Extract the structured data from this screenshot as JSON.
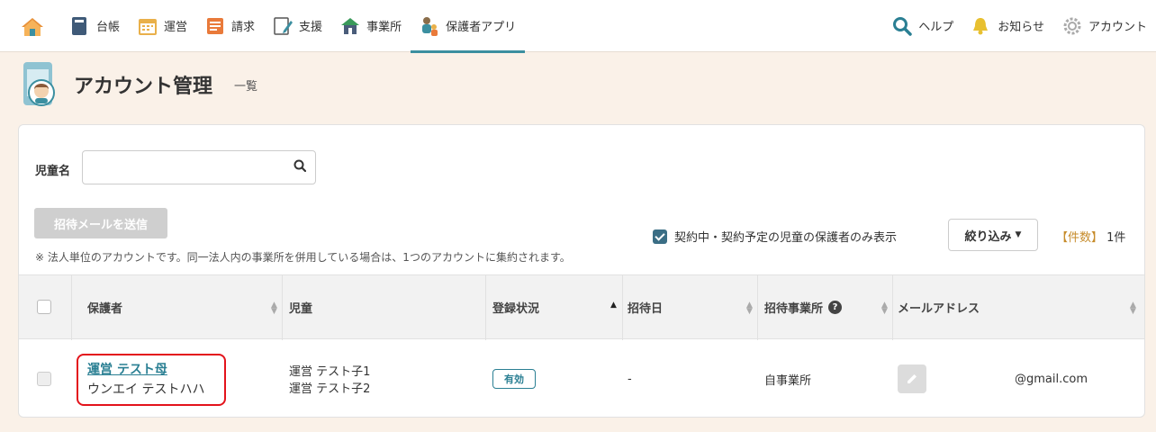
{
  "nav": {
    "items": [
      {
        "label": "台帳",
        "icon": "ledger-icon"
      },
      {
        "label": "運営",
        "icon": "calendar-icon"
      },
      {
        "label": "請求",
        "icon": "invoice-icon"
      },
      {
        "label": "支援",
        "icon": "support-icon"
      },
      {
        "label": "事業所",
        "icon": "office-icon"
      },
      {
        "label": "保護者アプリ",
        "icon": "parent-app-icon"
      }
    ],
    "active_index": 5,
    "help": "ヘルプ",
    "notice": "お知らせ",
    "account": "アカウント"
  },
  "page": {
    "title": "アカウント管理",
    "subtitle": "一覧"
  },
  "search": {
    "label": "児童名",
    "value": "",
    "placeholder": ""
  },
  "actions": {
    "invite_button": "招待メールを送信",
    "note": "※ 法人単位のアカウントです。同一法人内の事業所を併用している場合は、1つのアカウントに集約されます。",
    "filter_checkbox": "契約中・契約予定の児童の保護者のみ表示",
    "narrow_button": "絞り込み",
    "count_label": "【件数】",
    "count_value": "1件"
  },
  "table": {
    "headers": {
      "guardian": "保護者",
      "child": "児童",
      "status": "登録状況",
      "invite_date": "招待日",
      "invite_office": "招待事業所",
      "email": "メールアドレス"
    },
    "rows": [
      {
        "guardian_name": "運営 テスト母",
        "guardian_kana": "ウンエイ テストハハ",
        "children": [
          "運営 テスト子1",
          "運営 テスト子2"
        ],
        "status": "有効",
        "invite_date": "-",
        "invite_office": "自事業所",
        "email": "@gmail.com"
      }
    ]
  },
  "colors": {
    "accent": "#3b8fa0",
    "link": "#2a7f93",
    "background": "#faf1e8",
    "highlight": "#e3131b"
  }
}
